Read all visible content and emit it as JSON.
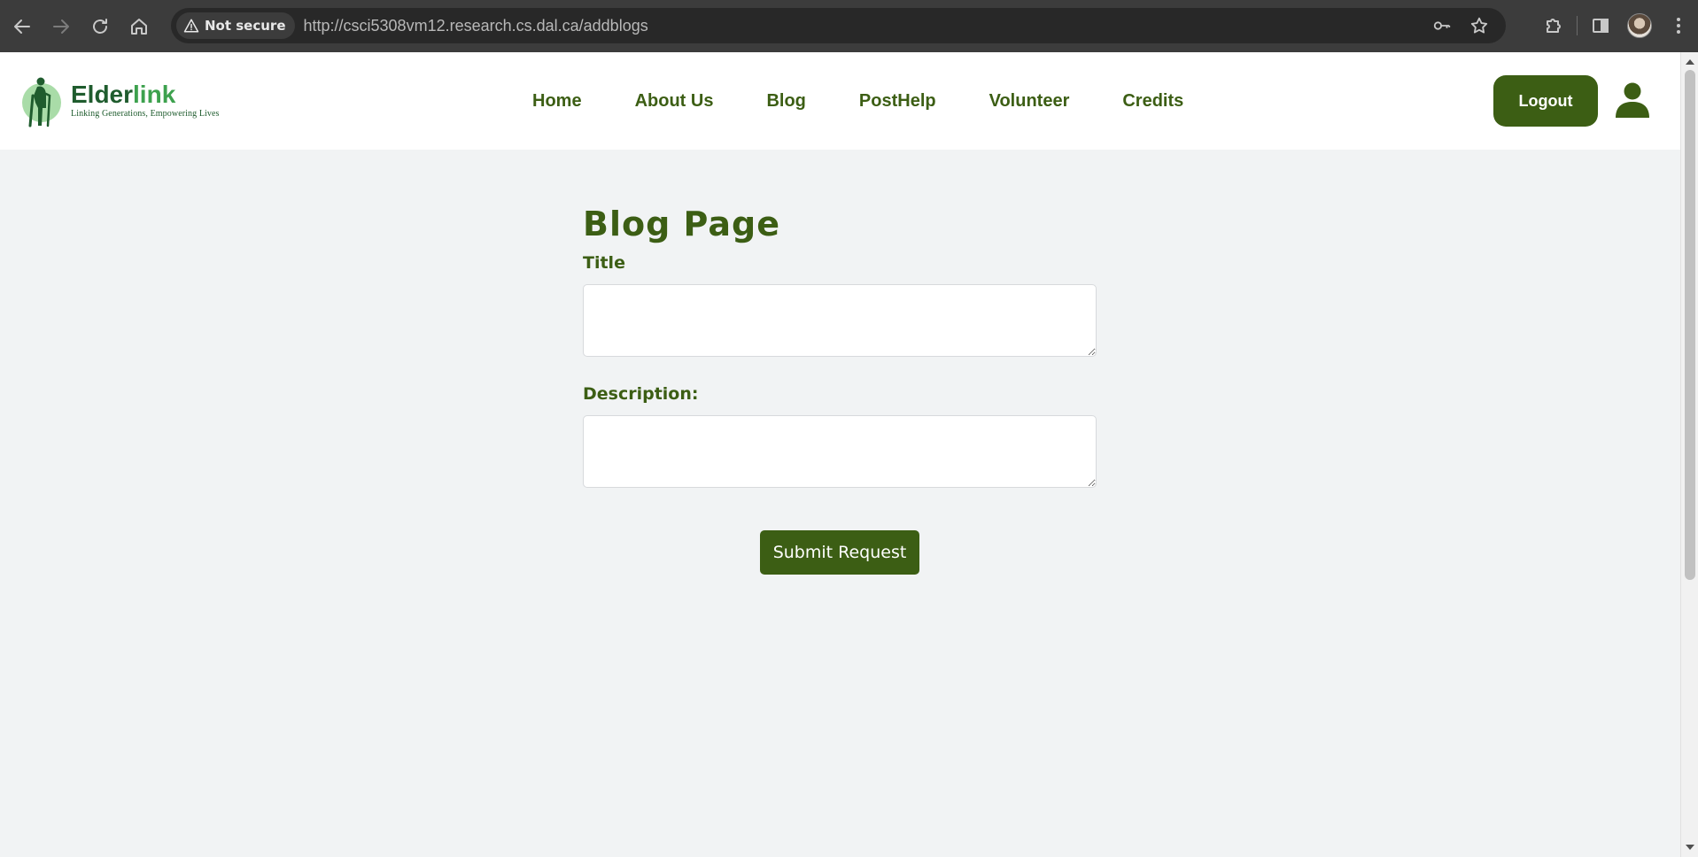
{
  "browser": {
    "security_label": "Not secure",
    "url": "http://csci5308vm12.research.cs.dal.ca/addblogs"
  },
  "header": {
    "brand_main": "Elder",
    "brand_accent": "link",
    "tagline": "Linking Generations, Empowering Lives",
    "nav": [
      {
        "label": "Home"
      },
      {
        "label": "About Us"
      },
      {
        "label": "Blog"
      },
      {
        "label": "PostHelp"
      },
      {
        "label": "Volunteer"
      },
      {
        "label": "Credits"
      }
    ],
    "logout_label": "Logout"
  },
  "form": {
    "page_title": "Blog Page",
    "title_label": "Title",
    "title_value": "",
    "description_label": "Description:",
    "description_value": "",
    "submit_label": "Submit Request"
  },
  "colors": {
    "primary_green": "#3c5e14",
    "brand_dark_green": "#1f5c2e",
    "brand_light_green": "#3da14e",
    "page_background": "#f1f3f4"
  },
  "icons": {
    "back": "arrow-left-icon",
    "forward": "arrow-right-icon",
    "reload": "reload-icon",
    "home": "home-icon",
    "warning": "warning-triangle-icon",
    "password": "key-icon",
    "bookmark": "star-icon",
    "extensions": "puzzle-icon",
    "side_panel": "side-panel-icon",
    "menu": "kebab-menu-icon",
    "user": "user-icon"
  }
}
